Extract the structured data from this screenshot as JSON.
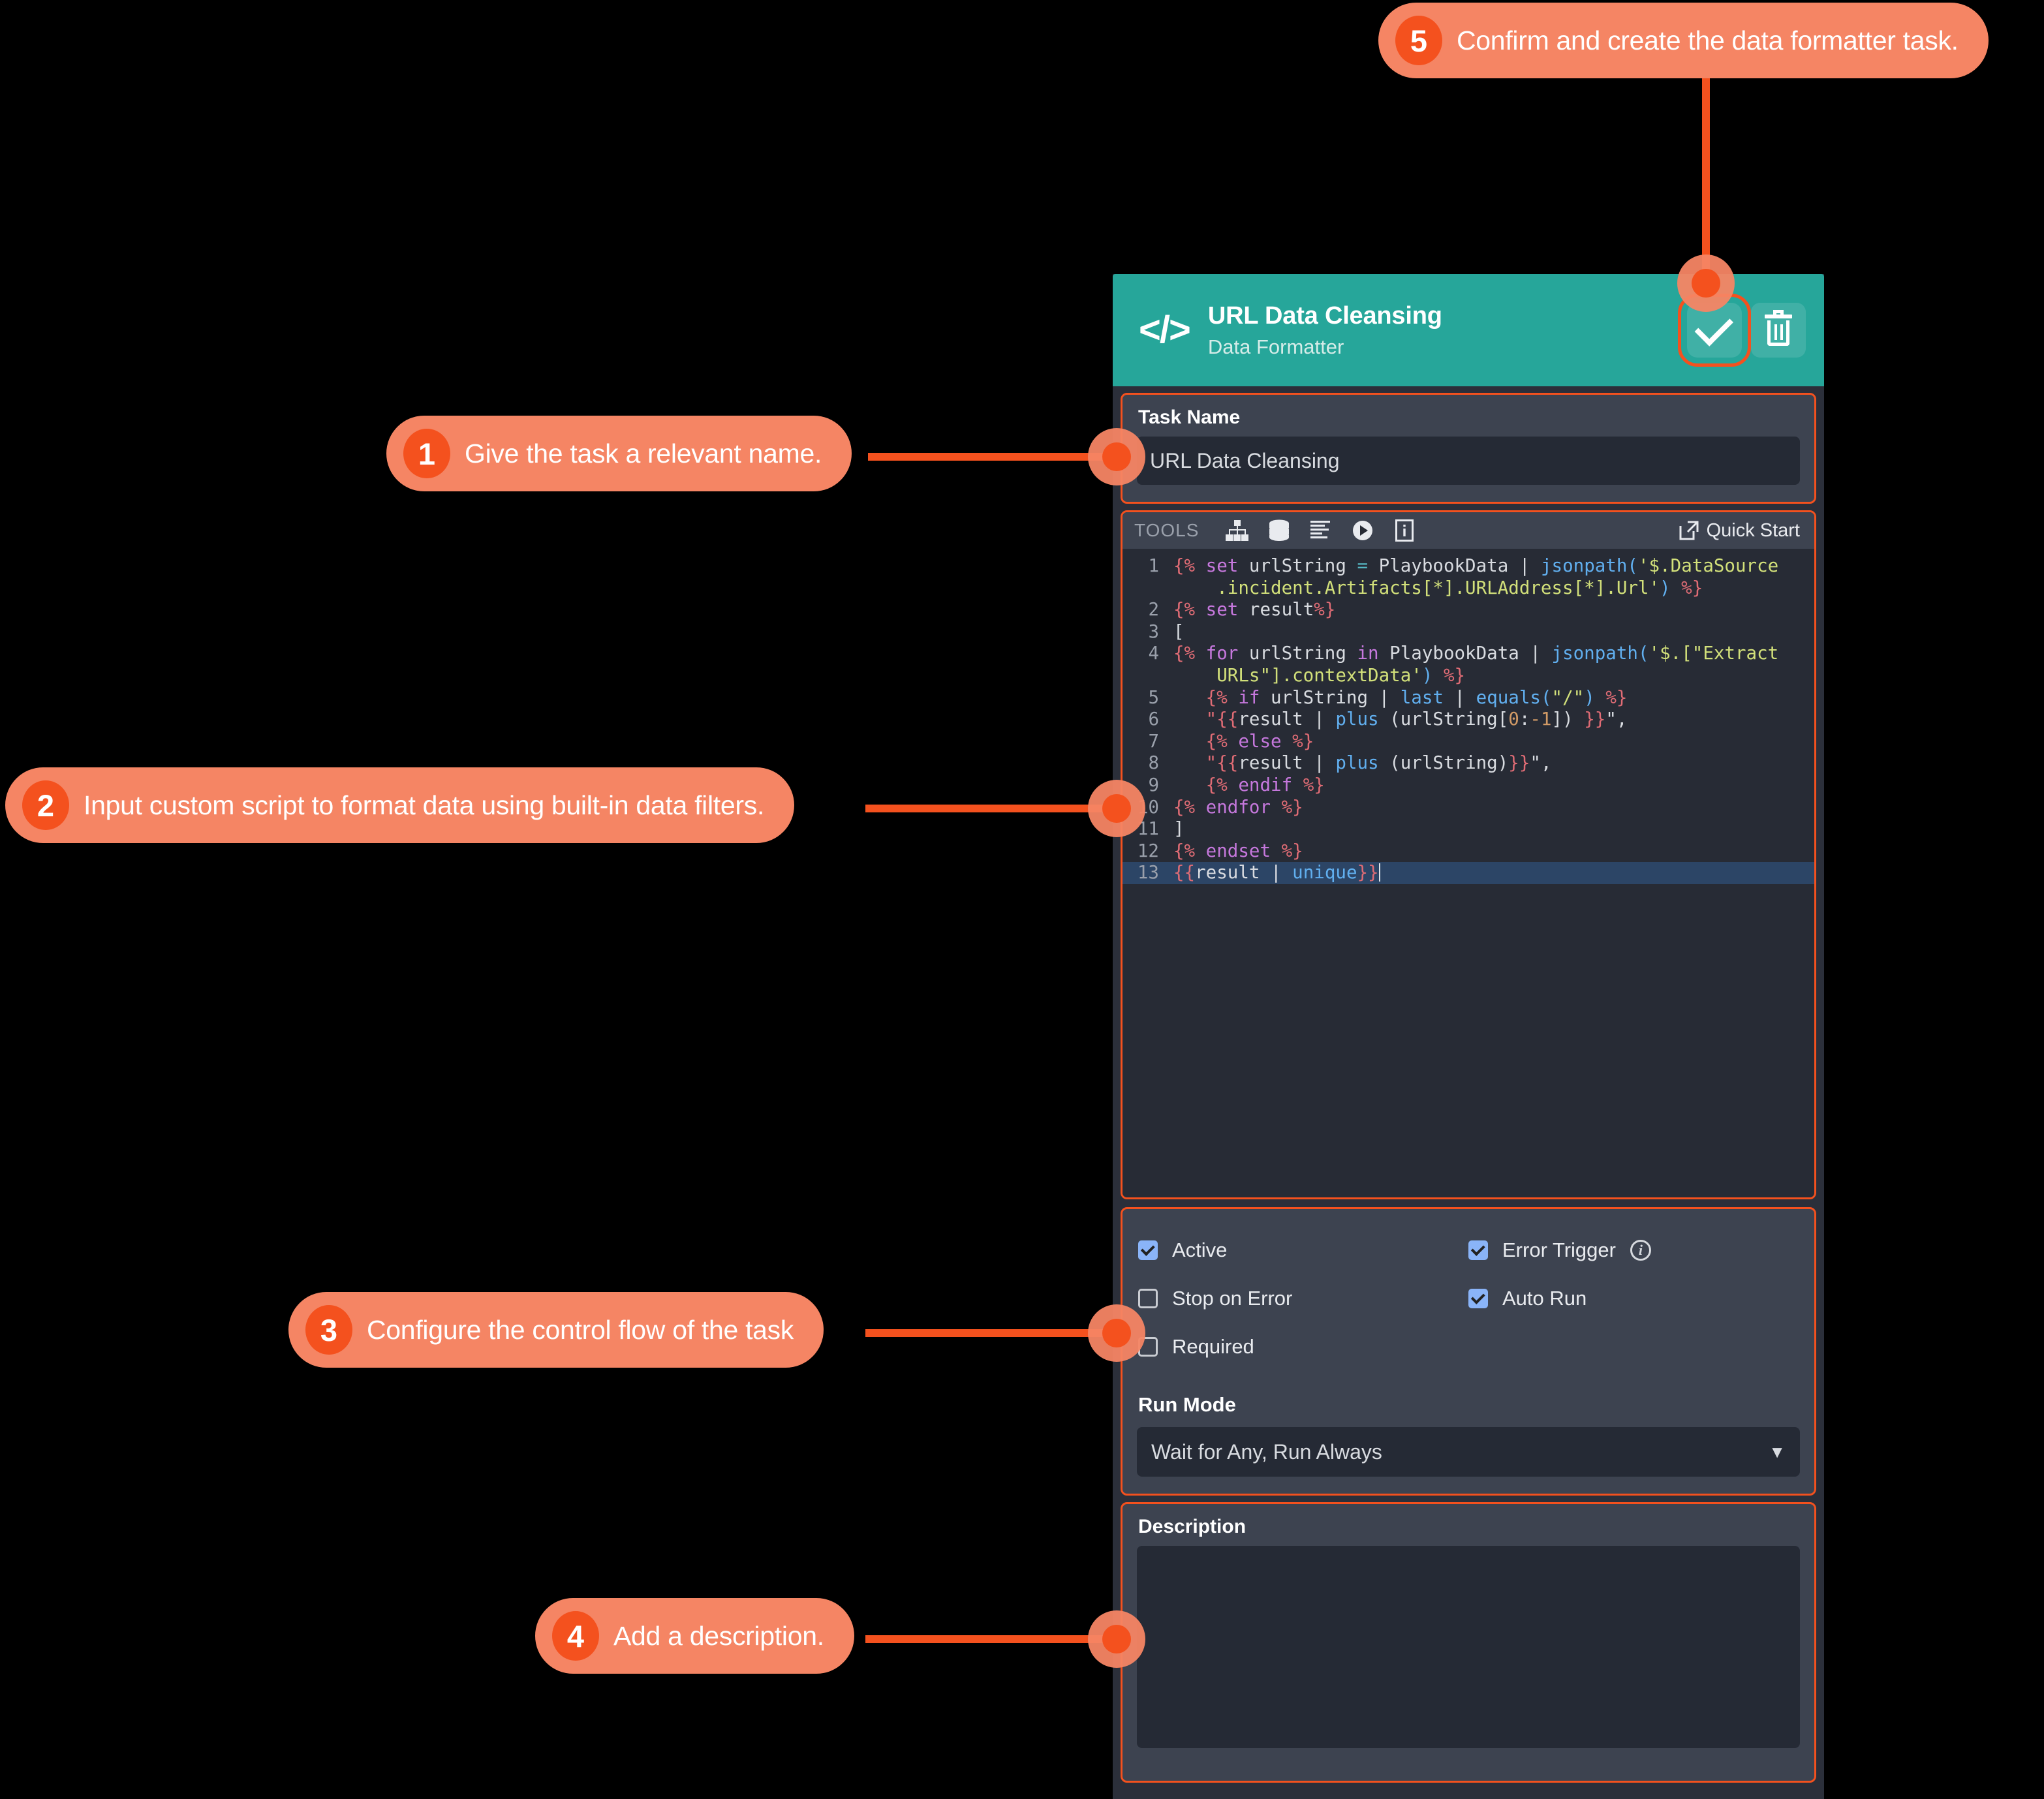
{
  "card": {
    "header": {
      "icon": "code-brackets-icon",
      "title": "URL Data Cleansing",
      "subtitle": "Data Formatter",
      "confirm_icon": "check-icon",
      "delete_icon": "trash-icon"
    },
    "task_name": {
      "label": "Task Name",
      "value": "URL Data Cleansing"
    },
    "editor": {
      "tools_label": "TOOLS",
      "tool_icons": [
        "sitemap-icon",
        "database-icon",
        "list-align-icon",
        "play-icon",
        "info-document-icon"
      ],
      "quick_start_label": "Quick Start",
      "quick_start_icon": "external-link-icon",
      "lines": [
        {
          "n": "1",
          "segments": [
            {
              "t": "{% ",
              "c": "tag"
            },
            {
              "t": "set ",
              "c": "kw"
            },
            {
              "t": "urlString ",
              "c": "var"
            },
            {
              "t": "= ",
              "c": "op"
            },
            {
              "t": "PlaybookData ",
              "c": "var"
            },
            {
              "t": "| ",
              "c": "var"
            },
            {
              "t": "jsonpath(",
              "c": "fn"
            },
            {
              "t": "'$.DataSource\n    .incident.Artifacts[*].URLAddress[*].Url'",
              "c": "str"
            },
            {
              "t": ") ",
              "c": "fn"
            },
            {
              "t": "%}",
              "c": "tag"
            }
          ]
        },
        {
          "n": "2",
          "segments": [
            {
              "t": "{% ",
              "c": "tag"
            },
            {
              "t": "set ",
              "c": "kw"
            },
            {
              "t": "result",
              "c": "var"
            },
            {
              "t": "%}",
              "c": "tag"
            }
          ]
        },
        {
          "n": "3",
          "segments": [
            {
              "t": "[",
              "c": "var"
            }
          ]
        },
        {
          "n": "4",
          "segments": [
            {
              "t": "{% ",
              "c": "tag"
            },
            {
              "t": "for ",
              "c": "kw"
            },
            {
              "t": "urlString ",
              "c": "var"
            },
            {
              "t": "in ",
              "c": "kw"
            },
            {
              "t": "PlaybookData ",
              "c": "var"
            },
            {
              "t": "| ",
              "c": "var"
            },
            {
              "t": "jsonpath(",
              "c": "fn"
            },
            {
              "t": "'$.[\"Extract\n    URLs\"].contextData'",
              "c": "str"
            },
            {
              "t": ") ",
              "c": "fn"
            },
            {
              "t": "%}",
              "c": "tag"
            }
          ]
        },
        {
          "n": "5",
          "segments": [
            {
              "t": "   {% ",
              "c": "tag"
            },
            {
              "t": "if ",
              "c": "kw"
            },
            {
              "t": "urlString ",
              "c": "var"
            },
            {
              "t": "| ",
              "c": "var"
            },
            {
              "t": "last ",
              "c": "fn"
            },
            {
              "t": "| ",
              "c": "var"
            },
            {
              "t": "equals(",
              "c": "fn"
            },
            {
              "t": "\"/\"",
              "c": "str"
            },
            {
              "t": ") ",
              "c": "fn"
            },
            {
              "t": "%}",
              "c": "tag"
            }
          ]
        },
        {
          "n": "6",
          "segments": [
            {
              "t": "   \"{{",
              "c": "tag"
            },
            {
              "t": "result ",
              "c": "var"
            },
            {
              "t": "| ",
              "c": "var"
            },
            {
              "t": "plus ",
              "c": "fn"
            },
            {
              "t": "(urlString[",
              "c": "var"
            },
            {
              "t": "0",
              "c": "num"
            },
            {
              "t": ":",
              "c": "var"
            },
            {
              "t": "-1",
              "c": "num"
            },
            {
              "t": "]) ",
              "c": "var"
            },
            {
              "t": "}}",
              "c": "tag"
            },
            {
              "t": "\",",
              "c": "var"
            }
          ]
        },
        {
          "n": "7",
          "segments": [
            {
              "t": "   {% ",
              "c": "tag"
            },
            {
              "t": "else ",
              "c": "kw"
            },
            {
              "t": "%}",
              "c": "tag"
            }
          ]
        },
        {
          "n": "8",
          "segments": [
            {
              "t": "   \"{{",
              "c": "tag"
            },
            {
              "t": "result ",
              "c": "var"
            },
            {
              "t": "| ",
              "c": "var"
            },
            {
              "t": "plus ",
              "c": "fn"
            },
            {
              "t": "(urlString)",
              "c": "var"
            },
            {
              "t": "}}",
              "c": "tag"
            },
            {
              "t": "\",",
              "c": "var"
            }
          ]
        },
        {
          "n": "9",
          "segments": [
            {
              "t": "   {% ",
              "c": "tag"
            },
            {
              "t": "endif ",
              "c": "kw"
            },
            {
              "t": "%}",
              "c": "tag"
            }
          ]
        },
        {
          "n": "10",
          "segments": [
            {
              "t": "{% ",
              "c": "tag"
            },
            {
              "t": "endfor ",
              "c": "kw"
            },
            {
              "t": "%}",
              "c": "tag"
            }
          ]
        },
        {
          "n": "11",
          "segments": [
            {
              "t": "]",
              "c": "var"
            }
          ]
        },
        {
          "n": "12",
          "segments": [
            {
              "t": "{% ",
              "c": "tag"
            },
            {
              "t": "endset ",
              "c": "kw"
            },
            {
              "t": "%}",
              "c": "tag"
            }
          ]
        },
        {
          "n": "13",
          "selected": true,
          "segments": [
            {
              "t": "{{",
              "c": "tag"
            },
            {
              "t": "result ",
              "c": "var"
            },
            {
              "t": "| ",
              "c": "var"
            },
            {
              "t": "unique",
              "c": "fn"
            },
            {
              "t": "}}",
              "c": "tag"
            }
          ]
        }
      ]
    },
    "options": {
      "left": [
        {
          "label": "Active",
          "checked": true
        },
        {
          "label": "Stop on Error",
          "checked": false
        },
        {
          "label": "Required",
          "checked": false
        }
      ],
      "right": [
        {
          "label": "Error Trigger",
          "checked": true,
          "info": true
        },
        {
          "label": "Auto Run",
          "checked": true,
          "info": false
        }
      ],
      "run_mode": {
        "label": "Run Mode",
        "value": "Wait for Any, Run Always",
        "caret_icon": "chevron-down-icon"
      }
    },
    "description": {
      "label": "Description",
      "value": ""
    }
  },
  "callouts": [
    {
      "num": "1",
      "text": "Give the task a relevant name."
    },
    {
      "num": "2",
      "text": "Input custom script to format data using built-in data filters."
    },
    {
      "num": "3",
      "text": "Configure the control flow of the task"
    },
    {
      "num": "4",
      "text": "Add a description."
    },
    {
      "num": "5",
      "text": "Confirm and create the data formatter task."
    }
  ],
  "colors": {
    "accent": "#F4511E",
    "callout_bg": "#F58564",
    "header_teal": "#26A69A",
    "panel_bg": "#3d4350",
    "field_bg": "#252a35",
    "checkbox_on": "#8ab4f8"
  }
}
